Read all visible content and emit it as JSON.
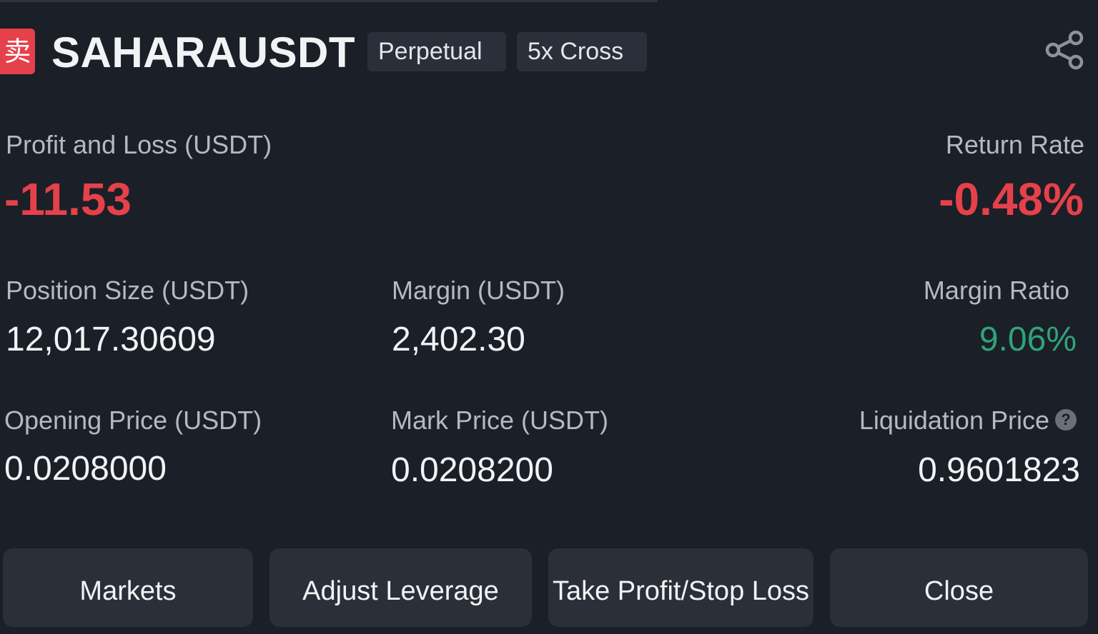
{
  "header": {
    "side_badge": "卖",
    "symbol": "SAHARAUSDT",
    "tags": [
      "Perpetual",
      "5x Cross"
    ],
    "share_icon": "share-icon"
  },
  "pnl": {
    "label": "Profit and Loss (USDT)",
    "value": "-11.53"
  },
  "return_rate": {
    "label": "Return Rate",
    "value": "-0.48%"
  },
  "position_size": {
    "label": "Position Size (USDT)",
    "value": "12,017.30609"
  },
  "margin": {
    "label": "Margin (USDT)",
    "value": "2,402.30"
  },
  "margin_ratio": {
    "label": "Margin Ratio",
    "value": "9.06%"
  },
  "opening_price": {
    "label": "Opening Price (USDT)",
    "value": "0.0208000"
  },
  "mark_price": {
    "label": "Mark Price (USDT)",
    "value": "0.0208200"
  },
  "liquidation_price": {
    "label": "Liquidation Price",
    "value": "0.9601823",
    "help": "?"
  },
  "actions": {
    "markets": "Markets",
    "adjust_leverage": "Adjust Leverage",
    "tp_sl": "Take Profit/Stop Loss",
    "close": "Close"
  },
  "colors": {
    "background": "#1b1f27",
    "loss": "#e5414b",
    "gain": "#2fa37a"
  }
}
